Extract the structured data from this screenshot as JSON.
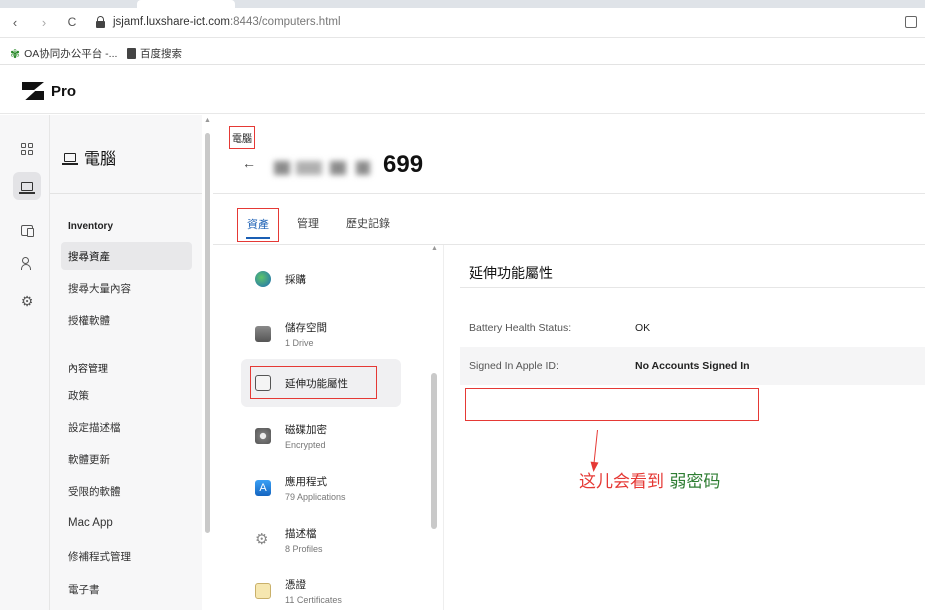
{
  "browser": {
    "url_host": "jsjamf.luxshare-ict.com",
    "url_path": ":8443/computers.html",
    "nav": {
      "back": "‹",
      "forward": "›",
      "reload": "C"
    }
  },
  "bookmarks": [
    {
      "label": "OA协同办公平台 -...",
      "icon": "flower-icon"
    },
    {
      "label": "百度搜索",
      "icon": "page-icon"
    }
  ],
  "app": {
    "product": "Pro"
  },
  "sidebar": {
    "title": "電腦",
    "sections": [
      {
        "heading": "Inventory",
        "items": [
          "搜尋資產",
          "搜尋大量內容",
          "授權軟體"
        ]
      },
      {
        "heading": "內容管理",
        "items": [
          "政策",
          "設定描述檔",
          "軟體更新",
          "受限的軟體",
          "Mac App",
          "修補程式管理",
          "電子書"
        ]
      }
    ],
    "active_item": "搜尋資產"
  },
  "main": {
    "breadcrumb": "電腦",
    "title_visible_suffix": "699",
    "tabs": [
      "資產",
      "管理",
      "歷史記錄"
    ],
    "active_tab": "資產",
    "categories": [
      {
        "label": "採購",
        "sub": "",
        "icon": "globe-icon"
      },
      {
        "label": "儲存空間",
        "sub": "1 Drive",
        "icon": "drive-icon"
      },
      {
        "label": "延伸功能屬性",
        "sub": "",
        "icon": "extension-icon"
      },
      {
        "label": "磁碟加密",
        "sub": "Encrypted",
        "icon": "disk-lock-icon"
      },
      {
        "label": "應用程式",
        "sub": "79 Applications",
        "icon": "appstore-icon"
      },
      {
        "label": "描述檔",
        "sub": "8 Profiles",
        "icon": "gears-icon"
      },
      {
        "label": "憑證",
        "sub": "11 Certificates",
        "icon": "certificate-icon"
      }
    ],
    "detail": {
      "title": "延伸功能屬性",
      "rows": [
        {
          "key": "Battery Health Status:",
          "value": "OK"
        },
        {
          "key": "Signed In Apple ID:",
          "value": "No Accounts Signed In"
        }
      ]
    }
  },
  "annotation": {
    "red_text": "这儿会看到",
    "green_text": "弱密码"
  },
  "colors": {
    "annotation_red": "#e53935",
    "annotation_green": "#2e7d32",
    "tab_active": "#1a5fb4"
  }
}
